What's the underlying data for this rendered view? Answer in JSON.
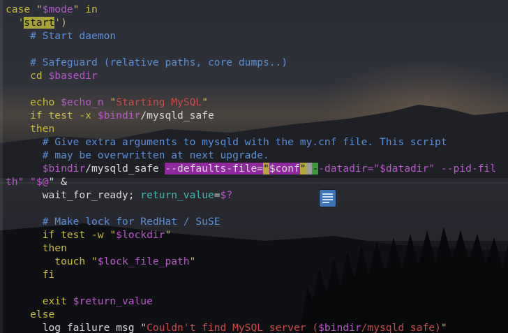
{
  "editor": {
    "lines": [
      {
        "parts": [
          {
            "t": "case ",
            "c": "kw"
          },
          {
            "t": "\"",
            "c": "str"
          },
          {
            "t": "$mode",
            "c": "var"
          },
          {
            "t": "\"",
            "c": "str"
          },
          {
            "t": " in",
            "c": "kw"
          }
        ]
      },
      {
        "parts": [
          {
            "t": "  '",
            "c": "str"
          },
          {
            "t": "start",
            "c": "hl-yellow"
          },
          {
            "t": "')",
            "c": "str"
          }
        ]
      },
      {
        "parts": [
          {
            "t": "    # Start daemon",
            "c": "cmt"
          }
        ]
      },
      {
        "parts": []
      },
      {
        "parts": [
          {
            "t": "    # Safeguard (relative paths, core dumps..)",
            "c": "cmt"
          }
        ]
      },
      {
        "parts": [
          {
            "t": "    cd ",
            "c": "kw"
          },
          {
            "t": "$basedir",
            "c": "var"
          }
        ]
      },
      {
        "parts": []
      },
      {
        "parts": [
          {
            "t": "    echo ",
            "c": "kw"
          },
          {
            "t": "$echo_n",
            "c": "var"
          },
          {
            "t": " \"",
            "c": "str"
          },
          {
            "t": "Starting MySQL",
            "c": "red"
          },
          {
            "t": "\"",
            "c": "str"
          }
        ]
      },
      {
        "parts": [
          {
            "t": "    if test -x ",
            "c": "kw"
          },
          {
            "t": "$bindir",
            "c": "var"
          },
          {
            "t": "/mysqld_safe",
            "c": "plain"
          }
        ]
      },
      {
        "parts": [
          {
            "t": "    then",
            "c": "kw"
          }
        ]
      },
      {
        "parts": [
          {
            "t": "      # Give extra arguments to mysqld with the my.cnf file. This script",
            "c": "cmt"
          }
        ]
      },
      {
        "parts": [
          {
            "t": "      # may be overwritten at next upgrade.",
            "c": "cmt"
          }
        ]
      },
      {
        "parts": [
          {
            "t": "      ",
            "c": "plain"
          },
          {
            "t": "$bindir",
            "c": "var"
          },
          {
            "t": "/mysqld_safe ",
            "c": "plain"
          },
          {
            "t": "--defaults-file=",
            "c": "hl-purple"
          },
          {
            "t": "\"",
            "c": "hl-gold"
          },
          {
            "t": "$conf",
            "c": "hl-purple"
          },
          {
            "t": "\"",
            "c": "hl-gold"
          },
          {
            "t": " ",
            "c": "hl-gray"
          },
          {
            "t": "-",
            "c": "hl-green"
          },
          {
            "t": "-datadir=\"",
            "c": "var"
          },
          {
            "t": "$datadir",
            "c": "var"
          },
          {
            "t": "\" --pid-fil",
            "c": "var"
          }
        ]
      },
      {
        "parts": [
          {
            "t": "th\" \"",
            "c": "var"
          },
          {
            "t": "$@",
            "c": "var"
          },
          {
            "t": "\" &",
            "c": "plain"
          }
        ]
      },
      {
        "parts": [
          {
            "t": "      wait_for_ready; ",
            "c": "plain"
          },
          {
            "t": "return_value",
            "c": "cyan"
          },
          {
            "t": "=",
            "c": "plain"
          },
          {
            "t": "$?",
            "c": "var"
          }
        ]
      },
      {
        "parts": []
      },
      {
        "parts": [
          {
            "t": "      # Make lock for RedHat / SuSE",
            "c": "cmt"
          }
        ]
      },
      {
        "parts": [
          {
            "t": "      if test -w \"",
            "c": "kw"
          },
          {
            "t": "$lockdir",
            "c": "var"
          },
          {
            "t": "\"",
            "c": "str"
          }
        ]
      },
      {
        "parts": [
          {
            "t": "      then",
            "c": "kw"
          }
        ]
      },
      {
        "parts": [
          {
            "t": "        touch \"",
            "c": "kw"
          },
          {
            "t": "$lock_file_path",
            "c": "var"
          },
          {
            "t": "\"",
            "c": "str"
          }
        ]
      },
      {
        "parts": [
          {
            "t": "      fi",
            "c": "kw"
          }
        ]
      },
      {
        "parts": []
      },
      {
        "parts": [
          {
            "t": "      exit ",
            "c": "kw"
          },
          {
            "t": "$return_value",
            "c": "var"
          }
        ]
      },
      {
        "parts": [
          {
            "t": "    else",
            "c": "kw"
          }
        ]
      },
      {
        "parts": [
          {
            "t": "      log_failure_msg \"",
            "c": "plain"
          },
          {
            "t": "Couldn't find MySQL server (",
            "c": "red"
          },
          {
            "t": "$bindir",
            "c": "var"
          },
          {
            "t": "/mysqld_safe)",
            "c": "red"
          },
          {
            "t": "\"",
            "c": "str"
          }
        ]
      }
    ]
  },
  "colors": {
    "keyword": "#c8bc3a",
    "string": "#c7b66e",
    "variable": "#b659c9",
    "comment": "#5a8fd6",
    "plain": "#d9d9d9",
    "cyan": "#43b8b0",
    "error_string": "#c94b4b",
    "match_highlight": "#a8a33a",
    "selection": "#8f2a9c"
  },
  "overlay_icon": "document-lines-icon"
}
